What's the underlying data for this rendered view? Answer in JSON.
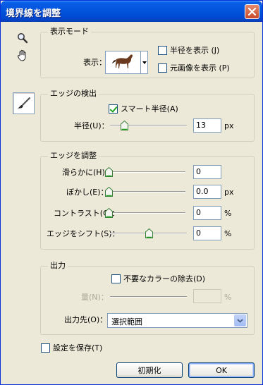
{
  "window": {
    "title": "境界線を調整"
  },
  "view_mode": {
    "group_label": "表示モード",
    "show_label": "表示：",
    "show_radius_label": "半径を表示 (J)",
    "show_original_label": "元画像を表示 (P)"
  },
  "edge_detection": {
    "group_label": "エッジの検出",
    "smart_radius_label": "スマート半径(A)",
    "radius_label": "半径(U)：",
    "radius_value": "13",
    "radius_unit": "px",
    "radius_slider_fraction": 0.18
  },
  "adjust_edge": {
    "group_label": "エッジを調整",
    "smooth_label": "滑らかに(H)：",
    "smooth_value": "0",
    "feather_label": "ぼかし(E)：",
    "feather_value": "0.0",
    "feather_unit": "px",
    "contrast_label": "コントラスト(C)：",
    "contrast_value": "0",
    "contrast_unit": "%",
    "shift_label": "エッジをシフト(S)：",
    "shift_value": "0",
    "shift_unit": "%",
    "shift_slider_fraction": 0.5
  },
  "output": {
    "group_label": "出力",
    "decontaminate_label": "不要なカラーの除去(D)",
    "amount_label": "量(N)：",
    "amount_unit": "%",
    "output_to_label": "出力先(O)：",
    "output_to_value": "選択範囲"
  },
  "remember_label": "設定を保存(T)",
  "buttons": {
    "reset_label": "初期化",
    "ok_label": "OK"
  },
  "colors": {
    "title_bar": "#0255dc",
    "dialog_bg": "#ece9d8",
    "check": "#21a121"
  }
}
